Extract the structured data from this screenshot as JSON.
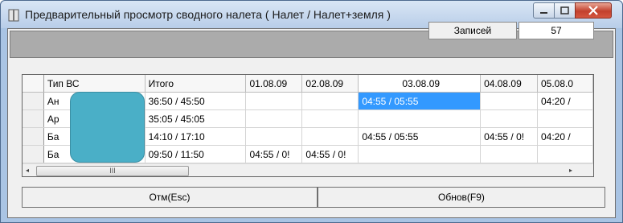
{
  "window": {
    "title": "Предварительный просмотр сводного налета ( Налет / Налет+земля )",
    "icon": "app-icon"
  },
  "records": {
    "label": "Записей",
    "value": "57"
  },
  "grid": {
    "columns": [
      "Тип ВС",
      "Итого",
      "01.08.09",
      "02.08.09",
      "03.08.09",
      "04.08.09",
      "05.08.0"
    ],
    "sorted_column": "03.08.09",
    "rows": [
      [
        "Ан",
        "36:50 / 45:50",
        "",
        "",
        "04:55 / 05:55",
        "",
        "04:20 /"
      ],
      [
        "Ар",
        "35:05 / 45:05",
        "",
        "",
        "",
        "",
        ""
      ],
      [
        "Ба",
        "14:10 / 17:10",
        "",
        "",
        "04:55 / 05:55",
        "04:55 / 0!",
        "04:20 /"
      ],
      [
        "Ба",
        "09:50 / 11:50",
        "04:55 / 0!",
        "04:55 / 0!",
        "",
        "",
        ""
      ]
    ],
    "selected_cell": {
      "row": 0,
      "column": "03.08.09"
    },
    "right_edge_fragments": [
      "о",
      "|",
      "о",
      "о"
    ]
  },
  "scrollbar": {
    "horizontal_thumb": "III",
    "left_arrow": "◂",
    "right_arrow": "▸",
    "up_arrow": "▴",
    "down_arrow": "▾"
  },
  "buttons": {
    "cancel": "Отм(Esc)",
    "refresh": "Обнов(F9)"
  },
  "colors": {
    "selection": "#3399ff",
    "overlay": "#4aafc7",
    "titlebar": "#b8cde8",
    "close_button": "#c2402c"
  }
}
